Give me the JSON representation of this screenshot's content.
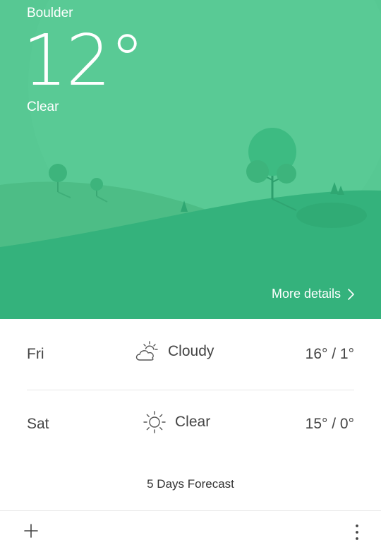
{
  "location": {
    "city": "Boulder"
  },
  "current": {
    "temperature": "12°",
    "condition": "Clear"
  },
  "more_details_label": "More details",
  "forecast": [
    {
      "day": "Fri",
      "condition": "Cloudy",
      "icon": "partly-cloudy-icon",
      "temps": "16° / 1°"
    },
    {
      "day": "Sat",
      "condition": "Clear",
      "icon": "sun-icon",
      "temps": "15° / 0°"
    }
  ],
  "five_days_label": "5 Days Forecast",
  "toolbar": {
    "add_icon": "plus-icon",
    "menu_icon": "more-vertical-icon"
  },
  "colors": {
    "sky": "#57c893",
    "hill_back": "#4fbf88",
    "hill_front": "#35b27d",
    "text_dark": "#444444"
  }
}
